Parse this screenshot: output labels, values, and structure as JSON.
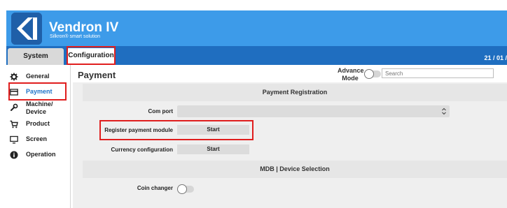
{
  "app": {
    "name": "Vendron IV",
    "subtitle": "Silkron® smart solution"
  },
  "tabs": [
    {
      "label": "System"
    },
    {
      "label": "Configuration"
    }
  ],
  "date": "21 / 01 /",
  "sidebar": {
    "items": [
      {
        "label": "General",
        "icon": "gear-icon"
      },
      {
        "label": "Payment",
        "icon": "card-icon",
        "active": true
      },
      {
        "label": "Machine/\nDevice",
        "icon": "wrench-icon"
      },
      {
        "label": "Product",
        "icon": "cart-icon"
      },
      {
        "label": "Screen",
        "icon": "monitor-icon"
      },
      {
        "label": "Operation",
        "icon": "info-icon"
      }
    ]
  },
  "main": {
    "title": "Payment",
    "advance_mode_label": "Advance\nMode",
    "search_placeholder": "Search",
    "sections": [
      {
        "title": "Payment Registration"
      },
      {
        "title": "MDB | Device Selection"
      }
    ],
    "fields": {
      "com_port": {
        "label": "Com port",
        "value": ""
      },
      "register_payment": {
        "label": "Register payment module",
        "button": "Start"
      },
      "currency_config": {
        "label": "Currency configuration",
        "button": "Start"
      },
      "coin_changer": {
        "label": "Coin changer",
        "enabled": false
      }
    },
    "advance_mode_enabled": false
  },
  "colors": {
    "header": "#3d9be9",
    "tabbar": "#1f6ec0",
    "active": "#1e73c8",
    "highlight": "#e01e1e"
  }
}
